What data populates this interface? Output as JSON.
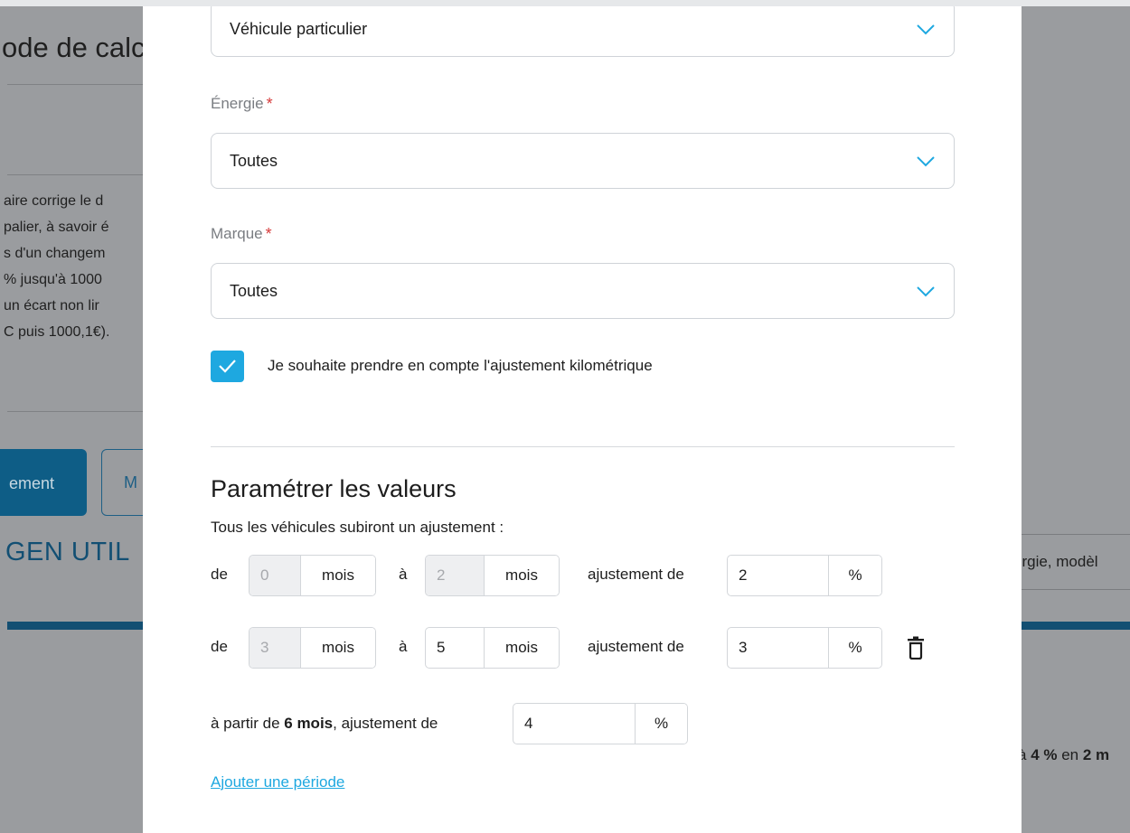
{
  "background": {
    "title": "ode de calc",
    "lines": [
      "aire corrige le d",
      "palier, à savoir é",
      "s d'un changem",
      "% jusqu'à 1000",
      " un écart non lir",
      "C puis 1000,1€)."
    ],
    "button_primary": "ement",
    "button_secondary": "M",
    "gen_label": "GEN UTIL",
    "right_box_text": "ergie, modèl",
    "right_text_prefix": "à ",
    "right_text_bold": "4 %",
    "right_text_mid": " en ",
    "right_text_bold2": "2 m"
  },
  "modal": {
    "vehicle_type": {
      "value": "Véhicule particulier"
    },
    "energy": {
      "label": "Énergie",
      "required_mark": "*",
      "value": "Toutes"
    },
    "brand": {
      "label": "Marque",
      "required_mark": "*",
      "value": "Toutes"
    },
    "mileage_adjustment": {
      "checked": true,
      "label": "Je souhaite prendre en compte l'ajustement kilométrique"
    },
    "values_section": {
      "title": "Paramétrer les valeurs",
      "subtitle": "Tous les véhicules subiront un ajustement :",
      "word_from": "de",
      "word_to": "à",
      "word_adjustment": "ajustement de",
      "unit_months": "mois",
      "unit_percent": "%",
      "periods": [
        {
          "from": "0",
          "to": "2",
          "adjustment": "2",
          "deletable": false
        },
        {
          "from": "3",
          "to": "5",
          "adjustment": "3",
          "deletable": true
        }
      ],
      "final": {
        "prefix": "à partir de ",
        "months_bold": "6 mois",
        "suffix": ", ajustement de",
        "adjustment": "4"
      },
      "add_period_link": "Ajouter une période"
    }
  },
  "colors": {
    "accent": "#1ea8e0",
    "required": "#d63b3b",
    "overlay": "#9a9c9f",
    "bg_primary": "#0e5d86"
  },
  "icons": {
    "chevron": "chevron-down-icon",
    "check": "check-icon",
    "trash": "trash-icon"
  }
}
